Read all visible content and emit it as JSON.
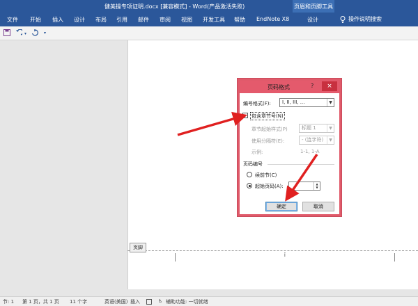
{
  "window": {
    "title": "健美操专项证明.docx [兼容模式] - Word(产品激活失败)",
    "context_group": "页眉和页脚工具"
  },
  "ribbon": {
    "tabs": [
      "文件",
      "开始",
      "插入",
      "设计",
      "布局",
      "引用",
      "邮件",
      "审阅",
      "视图",
      "开发工具",
      "帮助",
      "EndNote X8",
      "设计"
    ],
    "tell_me": "操作说明搜索",
    "accent": "#2b579a"
  },
  "quick_access": [
    "save-icon",
    "undo-icon",
    "redo-icon",
    "customize-icon"
  ],
  "document": {
    "footer_label": "页脚"
  },
  "dialog": {
    "title": "页码格式",
    "help": "?",
    "close": "×",
    "number_format_label": "编号格式(F):",
    "number_format_value": "I, II, III, ...",
    "include_chapter_label": "包含章节号(N)",
    "chapter_style_label": "章节起始样式(P)",
    "chapter_style_value": "标题 1",
    "separator_label": "使用分隔符(E):",
    "separator_value": "-  (连字符)",
    "example_label": "示例:",
    "example_value": "1-1, 1-A",
    "page_numbering_label": "页码编号",
    "continue_label": "续前节(C)",
    "start_at_label": "起始页码(A):",
    "start_at_value": "",
    "ok_label": "确定",
    "cancel_label": "取消",
    "border_color": "#e05a6a"
  },
  "statusbar": {
    "section": "节: 1",
    "page": "第 1 页，共 1 页",
    "words": "11 个字",
    "language": "英语(美国)",
    "mode": "插入",
    "accessibility": "辅助功能: 一切就绪"
  },
  "annotation_color": "#e02020"
}
